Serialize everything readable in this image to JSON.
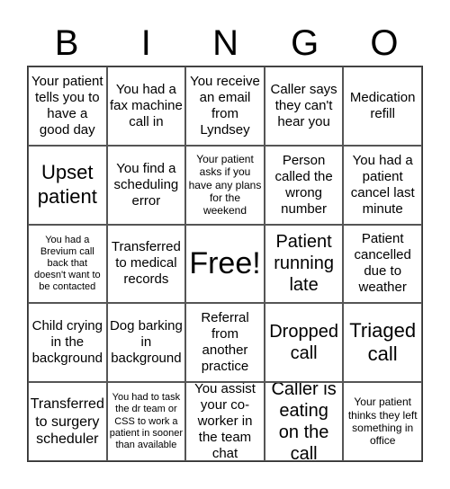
{
  "header": {
    "letters": [
      "B",
      "I",
      "N",
      "G",
      "O"
    ]
  },
  "cells": [
    "Your patient tells you to have a good day",
    "You had a fax machine call in",
    "You receive an email from Lyndsey",
    "Caller says they can't hear you",
    "Medication refill",
    "Upset patient",
    "You find a scheduling error",
    "Your patient asks if you have any plans for the weekend",
    "Person called the wrong number",
    "You had a patient cancel last minute",
    "You had a Brevium call back that doesn't want to be contacted",
    "Transferred to medical records",
    "Free!",
    "Patient running late",
    "Patient cancelled due to weather",
    "Child crying in the background",
    "Dog barking in background",
    "Referral from another practice",
    "Dropped call",
    "Triaged call",
    "Transferred to surgery scheduler",
    "You had to task the dr team or CSS to work a patient in sooner than available",
    "You assist your co-worker in the team chat",
    "Caller is eating on the call",
    "Your patient thinks they left something in office"
  ]
}
